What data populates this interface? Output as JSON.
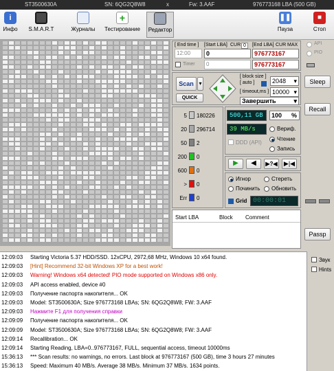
{
  "titlebar": {
    "model": "ST3500630A",
    "sn": "SN: 6QG2Q8W8",
    "close": "x",
    "fw": "Fw: 3.AAF",
    "lba": "976773168 LBA (500 GB)"
  },
  "toolbar": {
    "info": "Инфо",
    "smart": "S.M.A.R.T",
    "journals": "Журналы",
    "testing": "Тестирование",
    "editor": "Редактор",
    "pause": "Пауза",
    "stop": "Стоп"
  },
  "range": {
    "end_time_label": "[ End time ]",
    "start_lba_label": "[Start LBA]",
    "cur_label": "CUR",
    "cur_value": "0",
    "end_lba_label": "[End LBA]",
    "end_cur_label": "CUR",
    "max_label": "MAX",
    "time_value": "12:00",
    "timer_label": "Timer",
    "timer_value": "0",
    "start_lba": "0",
    "end_lba": "976773167",
    "end_lba2": "976773167",
    "start_lba2": "0"
  },
  "scan": {
    "scan_label": "Scan",
    "quick_label": "QUICK",
    "block_size_label": "[ block size ]",
    "auto_label": "[ auto ]",
    "block_size": "2048",
    "timeout_label": "[ timeout,ms ]",
    "timeout": "10000",
    "finish": "Завершить"
  },
  "stats": {
    "rows": [
      {
        "label": "5",
        "value": "180226",
        "color": "#c8c8c8"
      },
      {
        "label": "20",
        "value": "296714",
        "color": "#a8a8a8"
      },
      {
        "label": "50",
        "value": "2",
        "color": "#808080"
      },
      {
        "label": "200",
        "value": "0",
        "color": "#22c022"
      },
      {
        "label": "600",
        "value": "0",
        "color": "#e07010"
      },
      {
        "label": ">",
        "value": "0",
        "color": "#e01010"
      },
      {
        "label": "Err",
        "value": "0",
        "color": "#2040d0"
      }
    ]
  },
  "progress": {
    "size": "500,11 GB",
    "percent": "100",
    "percent_unit": "%",
    "speed": "39 MB/s",
    "verify": "Вериф.",
    "read": "Чтение",
    "write": "Запись",
    "ddd": "DDD (API)"
  },
  "errors": {
    "ignore": "Игнор",
    "erase": "Стереть",
    "repair": "Починить",
    "refresh": "Обновить",
    "grid": "Grid",
    "clock": "00:00:01"
  },
  "table": {
    "headers": [
      "Start LBA",
      "Block",
      "Comment"
    ]
  },
  "side": {
    "api": "API",
    "pio": "PIO",
    "sleep": "Sleep",
    "recall": "Recall",
    "passp": "Passp"
  },
  "logside": {
    "sound": "Звук",
    "hints": "Hints"
  },
  "log": [
    {
      "t": "12:09:03",
      "m": "Starting Victoria 5.37 HDD/SSD. 12xCPU, 2972,68 MHz, Windows 10 x64 found.",
      "c": "#000"
    },
    {
      "t": "12:09:03",
      "m": "[Hint] Recommend 32-bit Windows XP for a best work!",
      "c": "#c05000"
    },
    {
      "t": "12:09:03",
      "m": "Warning! Windows x64 detected! PIO mode supported on Windows x86 only.",
      "c": "#e00000"
    },
    {
      "t": "12:09:03",
      "m": "API access enabled, device #0",
      "c": "#000"
    },
    {
      "t": "12:09:03",
      "m": "Получение паспорта накопителя... OK",
      "c": "#000"
    },
    {
      "t": "12:09:03",
      "m": "Model: ST3500630A; Size 976773168 LBAs; SN: 6QG2Q8W8; FW: 3.AAF",
      "c": "#000"
    },
    {
      "t": "12:09:03",
      "m": "Нажмите F1 для получения справки",
      "c": "#c000c0"
    },
    {
      "t": "12:09:09",
      "m": "Получение паспорта накопителя... OK",
      "c": "#000"
    },
    {
      "t": "12:09:09",
      "m": "Model: ST3500630A; Size 976773168 LBAs; SN: 6QG2Q8W8; FW: 3.AAF",
      "c": "#000"
    },
    {
      "t": "12:09:14",
      "m": "Recallibration... OK",
      "c": "#000"
    },
    {
      "t": "12:09:14",
      "m": "Starting Reading, LBA=0..976773167, FULL, sequential access, timeout 10000ms",
      "c": "#000"
    },
    {
      "t": "15:36:13",
      "m": "*** Scan results: no warnings, no errors. Last block at 976773167 (500 GB), time 3 hours 27 minutes",
      "c": "#000"
    },
    {
      "t": "15:36:13",
      "m": "Speed: Maximum 40 MB/s. Average 38 MB/s. Minimum 37 MB/s. 1634 points.",
      "c": "#000"
    }
  ]
}
